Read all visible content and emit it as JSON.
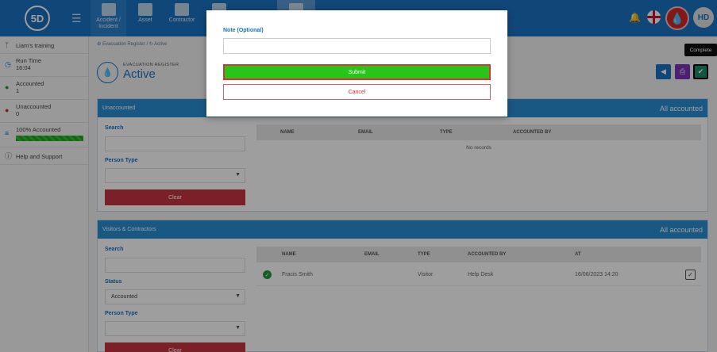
{
  "header": {
    "logo_text": "5D",
    "nav_tabs": [
      {
        "label": "Accident / Incident",
        "icon": "first-aid-icon"
      },
      {
        "label": "Asset",
        "icon": "boxes-icon"
      },
      {
        "label": "Contractor",
        "icon": "hard-hat-icon"
      }
    ],
    "avatar_initials": "HD"
  },
  "sidebar": {
    "training": "Liam's training",
    "run_time_label": "Run Time",
    "run_time_value": "16:04",
    "accounted_label": "Accounted",
    "accounted_value": "1",
    "unaccounted_label": "Unaccounted",
    "unaccounted_value": "0",
    "accounted_pct_label": "100% Accounted",
    "accounted_pct": 100,
    "help": "Help and Support"
  },
  "breadcrumb": {
    "parent": "Evacuation Register",
    "separator": "/",
    "current": "Active"
  },
  "page": {
    "subtitle": "EVACUATION REGISTER",
    "title": "Active"
  },
  "tooltip": "Complete",
  "unaccounted_panel": {
    "title": "Unaccounted",
    "status": "All accounted",
    "search_label": "Search",
    "person_type_label": "Person Type",
    "clear_label": "Clear",
    "columns": [
      "NAME",
      "EMAIL",
      "TYPE",
      "ACCOUNTED BY"
    ],
    "empty_text": "No records"
  },
  "visitors_panel": {
    "title": "Visitors & Contractors",
    "status": "All accounted",
    "search_label": "Search",
    "status_label": "Status",
    "status_value": "Accounted",
    "person_type_label": "Person Type",
    "clear_label": "Clear",
    "columns": [
      "NAME",
      "EMAIL",
      "TYPE",
      "ACCOUNTED BY",
      "AT"
    ],
    "rows": [
      {
        "name": "Fracis Smith",
        "email": "",
        "type": "Visitor",
        "accounted_by": "Help Desk",
        "at": "16/06/2023 14:20"
      }
    ]
  },
  "modal": {
    "note_label": "Note (Optional)",
    "note_value": "",
    "submit_label": "Submit",
    "cancel_label": "Cancel"
  },
  "colors": {
    "brand": "#1a73c4",
    "panel_header": "#2b8fd6",
    "submit": "#27c41a",
    "danger": "#c9343f"
  }
}
